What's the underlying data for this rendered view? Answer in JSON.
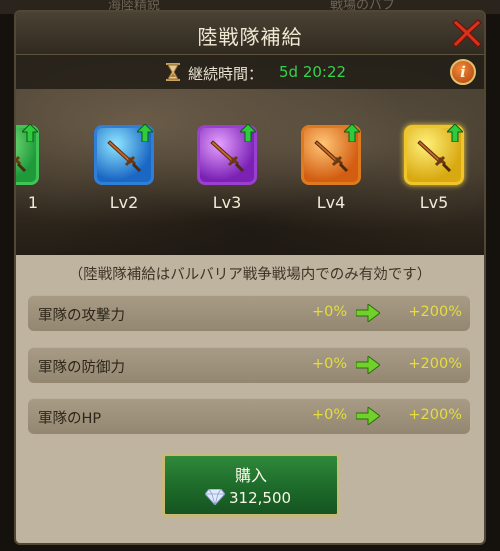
{
  "background_tabs": [
    "海陸精鋭",
    "戦場のバフ"
  ],
  "dialog": {
    "title": "陸戦隊補給",
    "timer_label": "継続時間：",
    "timer_value": "5d 20:22",
    "info_label": "i"
  },
  "levels": [
    {
      "label": "1",
      "color": "green"
    },
    {
      "label": "Lv2",
      "color": "blue"
    },
    {
      "label": "Lv3",
      "color": "purple"
    },
    {
      "label": "Lv4",
      "color": "orange"
    },
    {
      "label": "Lv5",
      "color": "gold"
    }
  ],
  "note": "（陸戦隊補給はバルバリア戦争戦場内でのみ有効です）",
  "stats": [
    {
      "label": "軍隊の攻撃力",
      "current": "+0%",
      "next": "+200%"
    },
    {
      "label": "軍隊の防御力",
      "current": "+0%",
      "next": "+200%"
    },
    {
      "label": "軍隊のHP",
      "current": "+0%",
      "next": "+200%"
    }
  ],
  "buy": {
    "label": "購入",
    "price": "312,500"
  },
  "colors": {
    "accent_green": "#35d24a",
    "value_yellow": "#e5dd3e",
    "close_red": "#d8321d"
  }
}
